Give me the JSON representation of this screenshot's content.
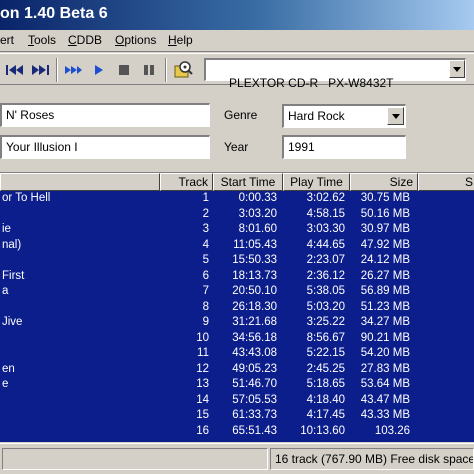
{
  "window": {
    "title": "on 1.40 Beta 6"
  },
  "menu": {
    "items": [
      {
        "pre": "",
        "u": "",
        "post": "ert"
      },
      {
        "pre": "",
        "u": "T",
        "post": "ools"
      },
      {
        "pre": "",
        "u": "C",
        "post": "DDB"
      },
      {
        "pre": "",
        "u": "O",
        "post": "ptions"
      },
      {
        "pre": "",
        "u": "H",
        "post": "elp"
      }
    ]
  },
  "toolbar": {
    "buttons": [
      "skip-back-icon",
      "skip-forward-icon",
      "fast-forward-icon",
      "play-icon",
      "stop-icon",
      "pause-icon",
      "cddb-lookup-icon"
    ],
    "drive": "PLEXTOR CD-R   PX-W8432T"
  },
  "info": {
    "artist": "N' Roses",
    "album": "Your Illusion I",
    "genre_label": "Genre",
    "genre": "Hard Rock",
    "year_label": "Year",
    "year": "1991"
  },
  "columns": [
    "",
    "Track",
    "Start Time",
    "Play Time",
    "Size",
    "S"
  ],
  "tracks": [
    {
      "title": "or To Hell",
      "track": "1",
      "start": "0:00.33",
      "play": "3:02.62",
      "size": "30.75 MB"
    },
    {
      "title": "",
      "track": "2",
      "start": "3:03.20",
      "play": "4:58.15",
      "size": "50.16 MB"
    },
    {
      "title": "ie",
      "track": "3",
      "start": "8:01.60",
      "play": "3:03.30",
      "size": "30.97 MB"
    },
    {
      "title": "nal)",
      "track": "4",
      "start": "11:05.43",
      "play": "4:44.65",
      "size": "47.92 MB"
    },
    {
      "title": "",
      "track": "5",
      "start": "15:50.33",
      "play": "2:23.07",
      "size": "24.12 MB"
    },
    {
      "title": "First",
      "track": "6",
      "start": "18:13.73",
      "play": "2:36.12",
      "size": "26.27 MB"
    },
    {
      "title": "a",
      "track": "7",
      "start": "20:50.10",
      "play": "5:38.05",
      "size": "56.89 MB"
    },
    {
      "title": "",
      "track": "8",
      "start": "26:18.30",
      "play": "5:03.20",
      "size": "51.23 MB"
    },
    {
      "title": "Jive",
      "track": "9",
      "start": "31:21.68",
      "play": "3:25.22",
      "size": "34.27 MB"
    },
    {
      "title": "",
      "track": "10",
      "start": "34:56.18",
      "play": "8:56.67",
      "size": "90.21 MB"
    },
    {
      "title": "",
      "track": "11",
      "start": "43:43.08",
      "play": "5:22.15",
      "size": "54.20 MB"
    },
    {
      "title": "en",
      "track": "12",
      "start": "49:05.23",
      "play": "2:45.25",
      "size": "27.83 MB"
    },
    {
      "title": "e",
      "track": "13",
      "start": "51:46.70",
      "play": "5:18.65",
      "size": "53.64 MB"
    },
    {
      "title": "",
      "track": "14",
      "start": "57:05.53",
      "play": "4:18.40",
      "size": "43.47 MB"
    },
    {
      "title": "",
      "track": "15",
      "start": "61:33.73",
      "play": "4:17.45",
      "size": "43.33 MB"
    },
    {
      "title": "",
      "track": "16",
      "start": "65:51.43",
      "play": "10:13.60",
      "size": "103.26"
    }
  ],
  "status": {
    "summary": "16 track (767.90 MB) Free disk space"
  },
  "colors": {
    "selection": "#0b1e8c",
    "face": "#d4d0c8",
    "title_start": "#0a246a",
    "title_end": "#a6caf0"
  }
}
